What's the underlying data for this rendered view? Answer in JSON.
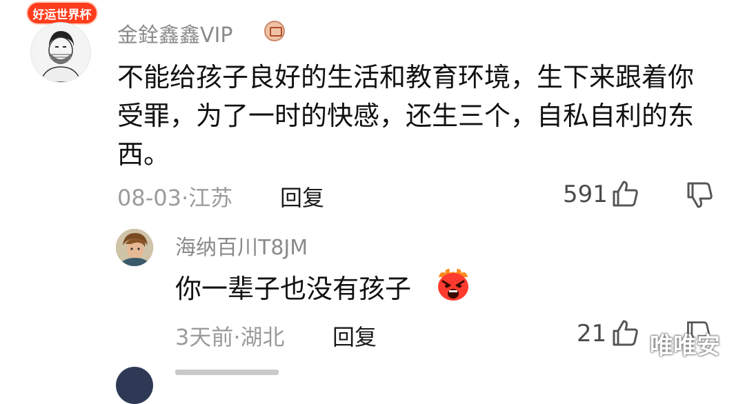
{
  "comment": {
    "badge": "好运世界杯",
    "username": "金銓鑫鑫VIP",
    "content": "不能给孩子良好的生活和教育环境，生下来跟着你受罪，为了一时的快感，还生三个，自私自利的东西。",
    "date": "08-03",
    "location": "江苏",
    "reply_label": "回复",
    "likes": "591",
    "icons": {
      "like": "thumbs-up-icon",
      "dislike": "thumbs-down-icon",
      "vip": "vip-icon"
    }
  },
  "reply": {
    "username": "海纳百川T8JM",
    "content": "你一辈子也没有孩子",
    "date": "3天前",
    "location": "湖北",
    "reply_label": "回复",
    "likes": "21",
    "icons": {
      "like": "thumbs-up-icon",
      "emoji": "screaming-face-emoji"
    }
  },
  "watermark": "唯唯安",
  "separator": "·"
}
